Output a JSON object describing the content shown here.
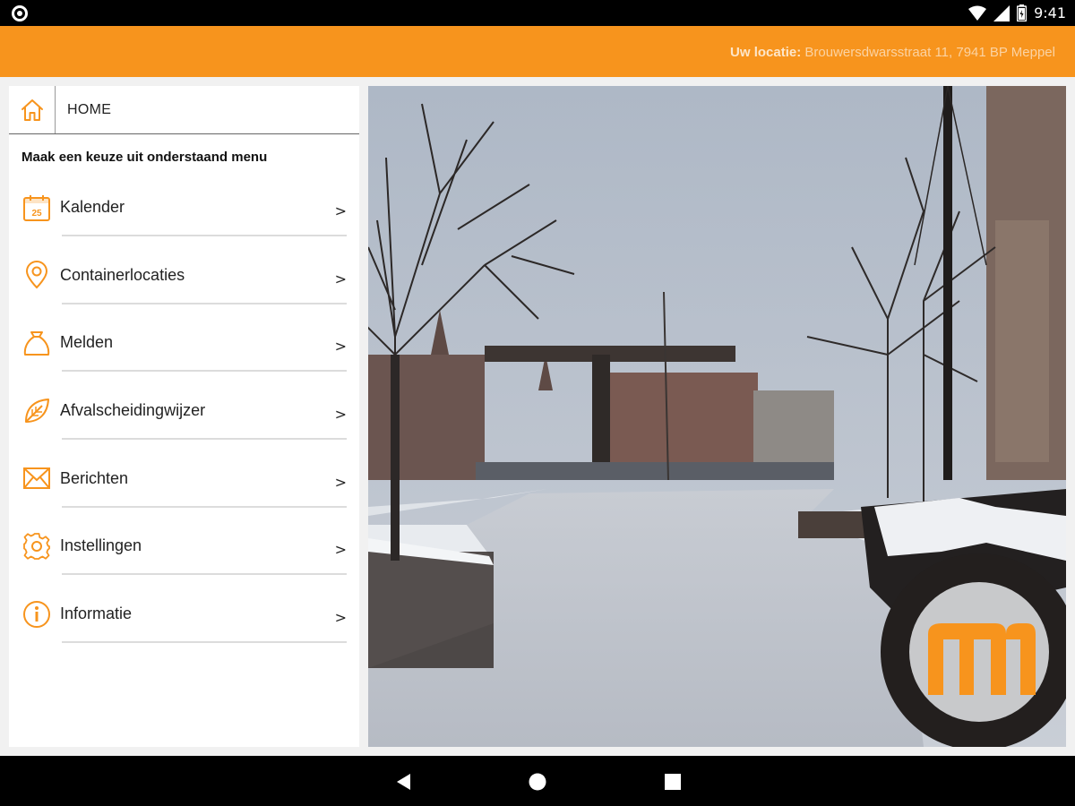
{
  "status_bar": {
    "time": "9:41",
    "icons": [
      "notification-icon",
      "wifi-icon",
      "signal-icon",
      "battery-icon"
    ]
  },
  "app_bar": {
    "location_label": "Uw locatie:",
    "location_value": "Brouwersdwarsstraat 11, 7941 BP Meppel"
  },
  "sidebar": {
    "home_label": "HOME",
    "intro": "Maak een keuze uit onderstaand menu",
    "items": [
      {
        "label": "Kalender",
        "icon": "calendar-icon",
        "chevron": ">"
      },
      {
        "label": "Containerlocaties",
        "icon": "location-pin-icon",
        "chevron": ">"
      },
      {
        "label": "Melden",
        "icon": "bag-icon",
        "chevron": ">"
      },
      {
        "label": "Afvalscheidingwijzer",
        "icon": "leaf-icon",
        "chevron": ">"
      },
      {
        "label": "Berichten",
        "icon": "envelope-icon",
        "chevron": ">"
      },
      {
        "label": "Instellingen",
        "icon": "gear-icon",
        "chevron": ">"
      },
      {
        "label": "Informatie",
        "icon": "info-icon",
        "chevron": ">"
      }
    ]
  },
  "calendar_icon_day": "25",
  "colors": {
    "accent": "#f7941d",
    "status_bar": "#000000",
    "nav_bar": "#000000",
    "panel_bg": "#ffffff",
    "page_bg": "#f1f1f1"
  },
  "nav_bar": {
    "buttons": [
      "back-icon",
      "home-circle-icon",
      "recents-square-icon"
    ]
  },
  "photo": {
    "description_icon": "meppel-logo-icon"
  }
}
